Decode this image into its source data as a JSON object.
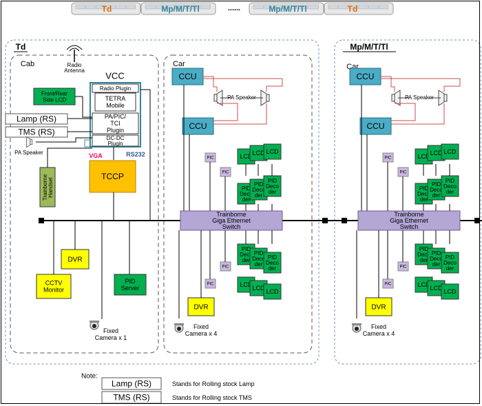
{
  "train_header": {
    "cars": [
      {
        "label": "Td"
      },
      {
        "label": "Mp/M/T/Tl"
      },
      {
        "label": "Mp/M/T/Tl"
      },
      {
        "label": "Td"
      }
    ],
    "ellipsis": "......"
  },
  "sections": {
    "td": {
      "title": "Td",
      "cab": {
        "title": "Cab",
        "radio_antenna": "Radio\nAntenna",
        "vcc": "VCC",
        "front_rear_lcd": "Front/Rear\nSide LCD",
        "radio_plugin": "Radio Plugin",
        "tetra_mobile": "TETRA\nMobile",
        "pa_pic_tci_plugin": "PA/PIC/\nTCI\nPlugin",
        "dc_dc_plugin": "DC-DC\nPlugin",
        "lamp_rs": "Lamp (RS)",
        "tms_rs": "TMS (RS)",
        "pa_speaker": "PA Speaker",
        "trainborne_handset": "Trainborne\nHandset",
        "vga": "VGA",
        "rs232": "RS232",
        "tccp": "TCCP",
        "dvr": "DVR",
        "cctv_monitor": "CCTV\nMonitor",
        "pid_server": "PID\nServer",
        "fixed_camera": "Fixed\nCamera x 1"
      },
      "car": {
        "title": "Car",
        "ccu_top": "CCU",
        "pa_speaker": "PA Speaker",
        "ccu_mid": "CCU",
        "pic": "PIC",
        "lcd": "LCD",
        "pid_decoder": "PID\nDeco\nder",
        "switch": "Trainborne\nGiga Ethernet\nSwitch",
        "dvr": "DVR",
        "fixed_camera": "Fixed\nCamera x 4"
      }
    },
    "mp": {
      "title": "Mp/M/T/Tl",
      "car": {
        "title": "Car",
        "ccu_top": "CCU",
        "pa_speaker": "PA Speaker",
        "ccu_mid": "CCU",
        "pic": "PIC",
        "lcd": "LCD",
        "pid_decoder": "PID\nDeco\nder",
        "switch": "Trainborne\nGiga Ethernet\nSwitch",
        "dvr": "DVR",
        "fixed_camera": "Fixed\nCamera x 4"
      }
    }
  },
  "note": {
    "title": "Note:",
    "items": [
      {
        "term": "Lamp (RS)",
        "desc": "Stands for  Rolling stock Lamp"
      },
      {
        "term": "TMS (RS)",
        "desc": "Stands for  Rolling stock TMS"
      }
    ]
  },
  "colors": {
    "ccu": "#4bacc6",
    "tccp": "#ffc000",
    "yellow": "#ffff00",
    "green": "#00b050",
    "handset": "#9bbb59",
    "switch": "#b4a7d6",
    "pic": "#c9b8e0",
    "line": "#000000",
    "red": "#c0504d",
    "vcc_border": "#31849b"
  }
}
